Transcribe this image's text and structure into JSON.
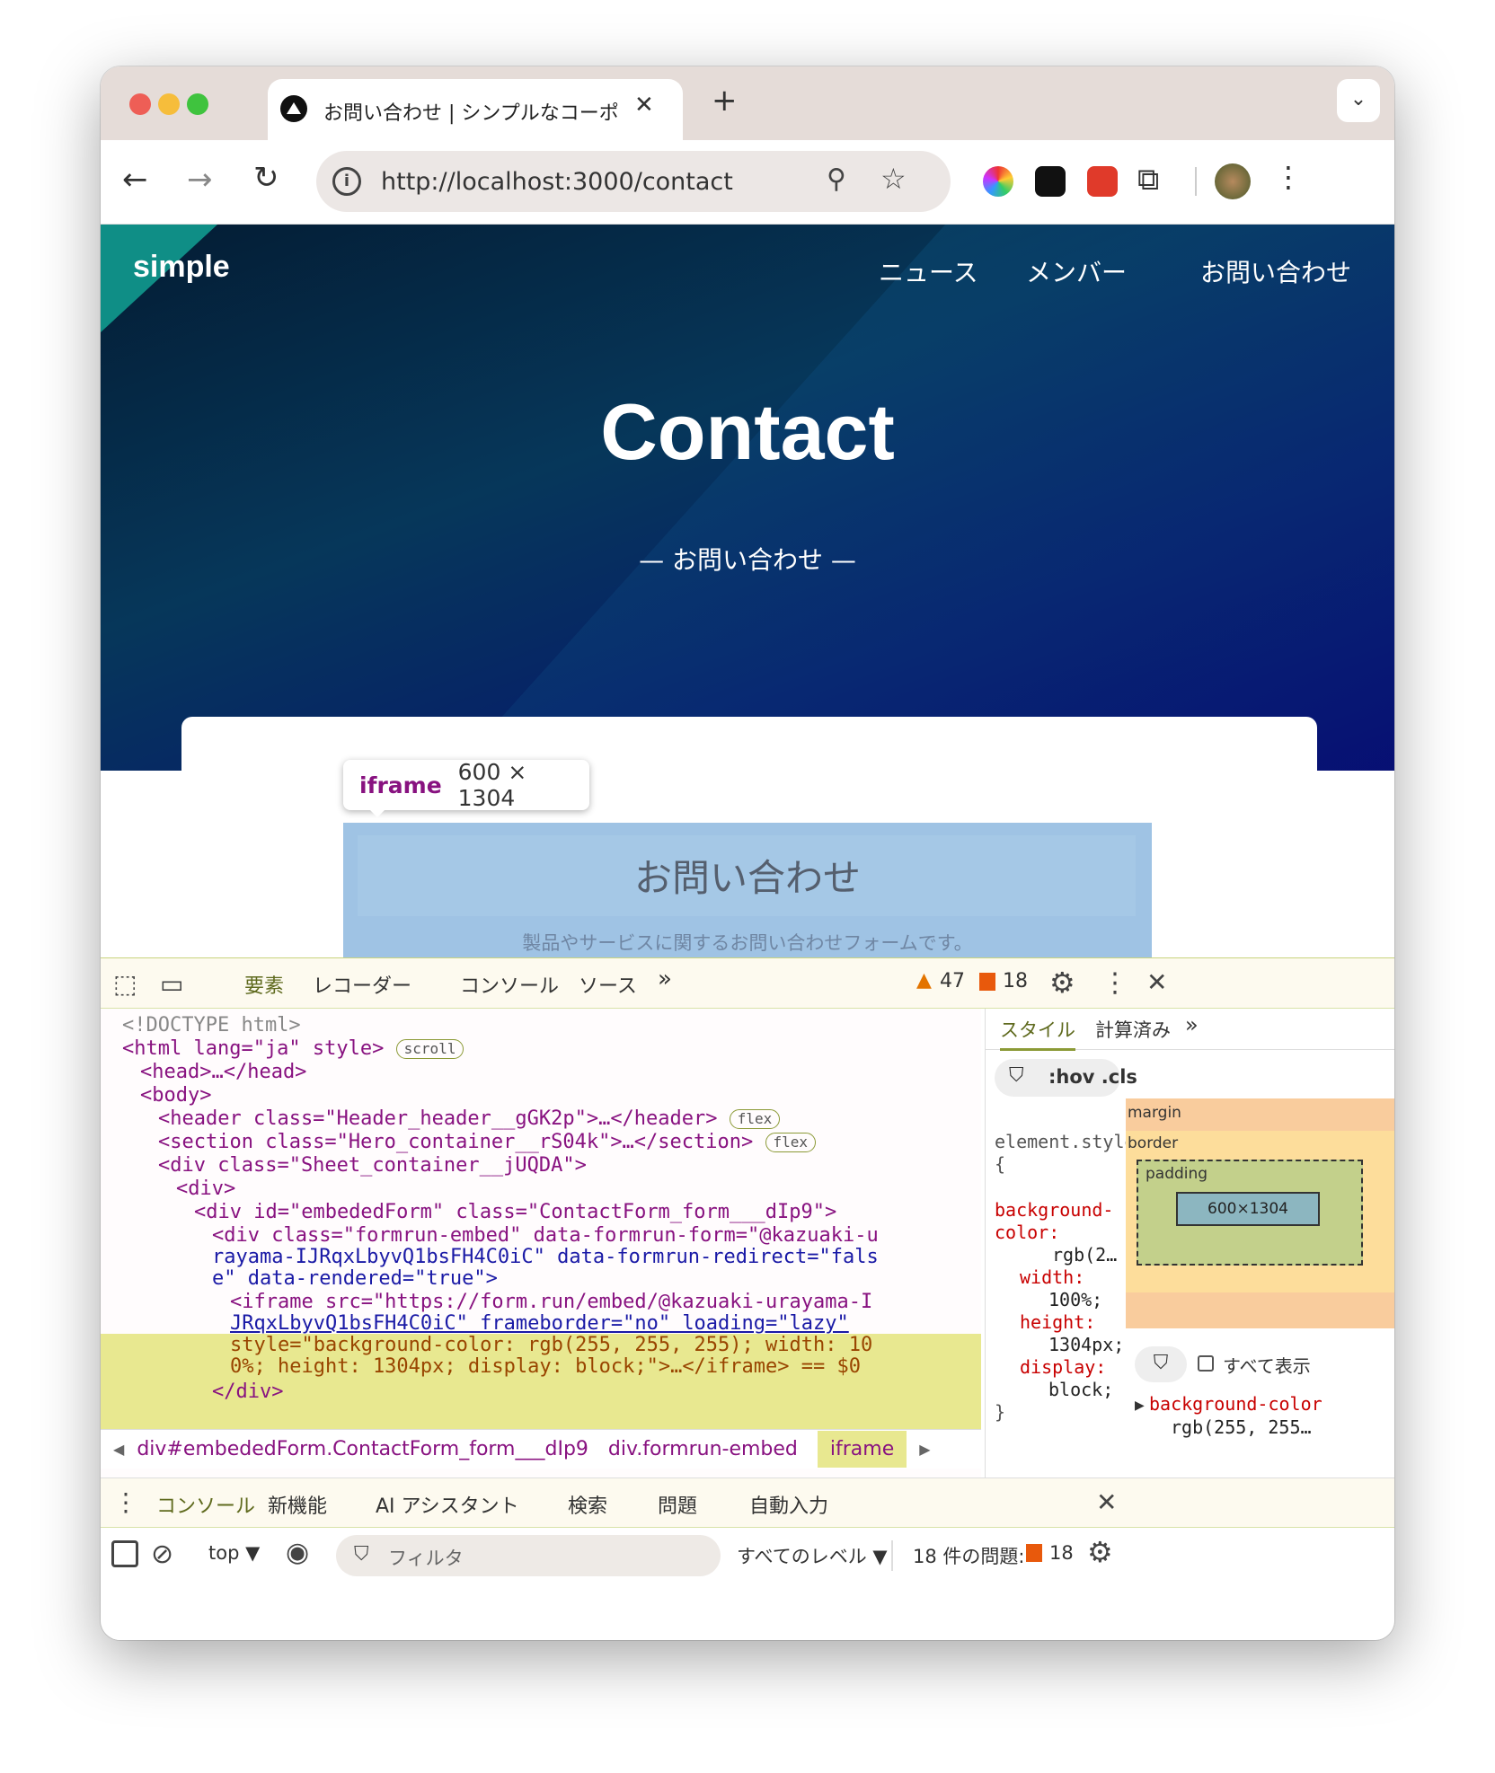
{
  "browser": {
    "tab_title": "お問い合わせ | シンプルなコーポ",
    "url": "http://localhost:3000/contact"
  },
  "site": {
    "logo": "simple",
    "nav": [
      "ニュース",
      "メンバー",
      "お問い合わせ"
    ],
    "hero_title": "Contact",
    "hero_subtitle": "—  お問い合わせ  —",
    "form_title": "お問い合わせ",
    "form_desc": "製品やサービスに関するお問い合わせフォームです。"
  },
  "tooltip": {
    "tag": "iframe",
    "size": "600 × 1304"
  },
  "devtools": {
    "tabs": [
      "要素",
      "レコーダー",
      "コンソール",
      "ソース",
      "»"
    ],
    "warnings": "47",
    "errors": "18",
    "dom_lines": [
      "<!DOCTYPE html>",
      "<html lang=\"ja\" style>",
      "<head>…</head>",
      "<body>",
      "<header class=\"Header_header__gGK2p\">…</header>",
      "<section class=\"Hero_container__rS04k\">…</section>",
      "<div class=\"Sheet_container__jUQDA\">",
      "<div>",
      "<div id=\"embededForm\" class=\"ContactForm_form___dIp9\">",
      "<div class=\"formrun-embed\" data-formrun-form=\"@kazuaki-u",
      "rayama-IJRqxLbyvQ1bsFH4C0iC\" data-formrun-redirect=\"fals",
      "e\" data-rendered=\"true\">",
      "<iframe src=\"https://form.run/embed/@kazuaki-urayama-I",
      "JRqxLbyvQ1bsFH4C0iC\" frameborder=\"no\" loading=\"lazy\"",
      "style=\"background-color: rgb(255, 255, 255); width: 10",
      "0%; height: 1304px; display: block;\">…</iframe> == $0",
      "</div>"
    ],
    "badges": {
      "scroll": "scroll",
      "flex": "flex"
    },
    "breadcrumbs": [
      "div#embededForm.ContactForm_form___dIp9",
      "div.formrun-embed",
      "iframe"
    ],
    "styles_tabs": [
      "スタイル",
      "計算済み",
      "»"
    ],
    "styles_filter": ":hov .cls",
    "style_rule": [
      "element.style {",
      "background-color:",
      "rgb(2…",
      "width:",
      "100%;",
      "height:",
      "1304px;",
      "display:",
      "block;",
      "}"
    ],
    "box_model": {
      "margin": "margin",
      "border": "border",
      "padding": "padding",
      "content": "600×1304",
      "dash": "–"
    },
    "computed_filter_label": "すべて表示",
    "computed_prop": "background-color",
    "computed_val": "rgb(255, 255…",
    "console_tabs": [
      "コンソール",
      "新機能",
      "AI アシスタント",
      "検索",
      "問題",
      "自動入力"
    ],
    "console_context": "top ▼",
    "console_filter": "フィルタ",
    "console_levels": "すべてのレベル ▼",
    "issues_label": "18 件の問題:",
    "issues_count": "18"
  }
}
